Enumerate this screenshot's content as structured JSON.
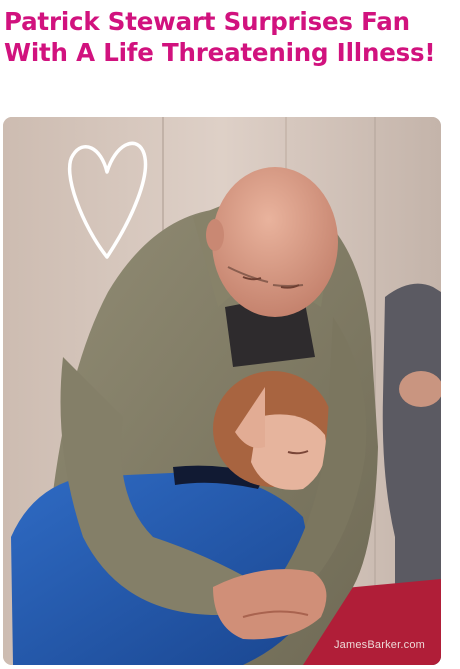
{
  "article": {
    "headline": "Patrick Stewart Surprises Fan With A Life Threatening Illness!",
    "photo_credit": "JamesBarker.com"
  },
  "colors": {
    "headline": "#d1127e",
    "wall": "#d8cac1",
    "jacket": "#7f7a63",
    "shirt": "#2255a8",
    "carpet": "#b01e38"
  },
  "icons": {
    "heart": "heart-doodle-icon"
  }
}
